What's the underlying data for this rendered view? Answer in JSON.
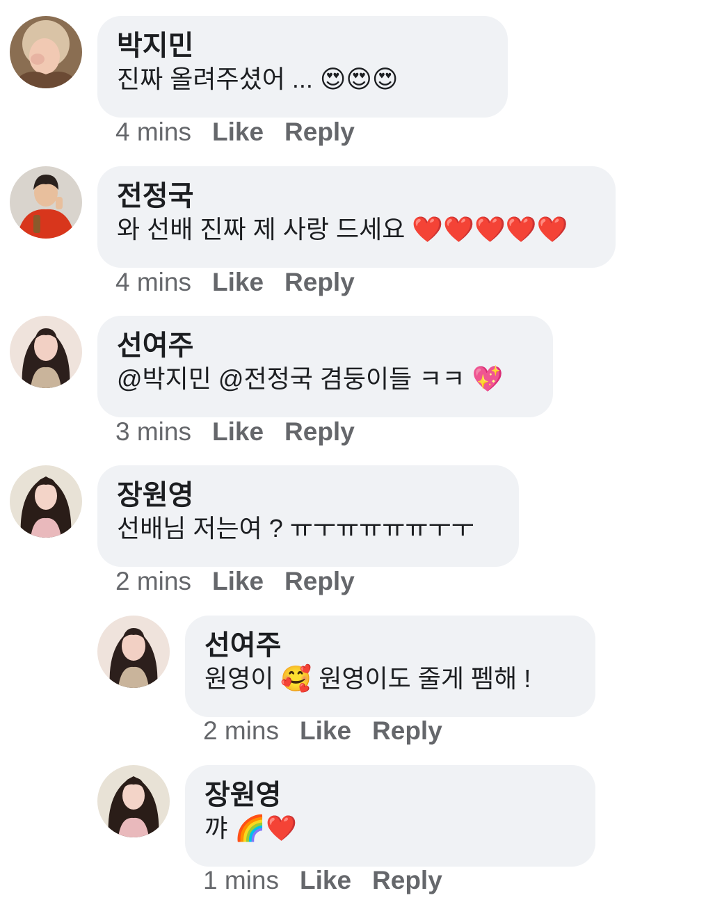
{
  "comments": [
    {
      "author": "박지민",
      "text": "진짜 올려주셨어 ...",
      "emoji": "😍😍😍",
      "time": "4 mins",
      "like": "Like",
      "reply": "Reply"
    },
    {
      "author": "전정국",
      "text": "와 선배 진짜 제 사랑 드세요",
      "emoji": "❤️❤️❤️❤️❤️",
      "time": "4 mins",
      "like": "Like",
      "reply": "Reply"
    },
    {
      "author": "선여주",
      "text": "@박지민 @전정국  겸둥이들 ㅋㅋ",
      "emoji": "💖",
      "time": "3 mins",
      "like": "Like",
      "reply": "Reply"
    },
    {
      "author": "장원영",
      "text": "선배님 저는여 ? ㅠㅜㅠㅠㅠㅠㅜㅜ",
      "emoji": "",
      "time": "2 mins",
      "like": "Like",
      "reply": "Reply"
    },
    {
      "author": "선여주",
      "text_before": "원영이",
      "emoji": "🥰",
      "text_after": "원영이도 줄게 펨해 !",
      "time": "2 mins",
      "like": "Like",
      "reply": "Reply"
    },
    {
      "author": "장원영",
      "text": "꺄",
      "emoji": "🌈❤️",
      "time": "1 mins",
      "like": "Like",
      "reply": "Reply"
    }
  ],
  "avatars": {
    "jimin": {
      "bg": "#8a6e52",
      "hair": "#d9c3a6",
      "skin": "#f1c9b3"
    },
    "jungkook": {
      "bg": "#d9d4cd",
      "hair": "#2a211d",
      "skin": "#e8bf9d",
      "jacket": "#d8361c"
    },
    "yeoju": {
      "bg": "#efe3dc",
      "hair": "#2c1f1c",
      "skin": "#f2d0c4",
      "top": "#c9b49b"
    },
    "wonyoung": {
      "bg": "#e8e2d6",
      "hair": "#2a1d18",
      "skin": "#f3d4c8",
      "top": "#e9b9bc"
    }
  }
}
